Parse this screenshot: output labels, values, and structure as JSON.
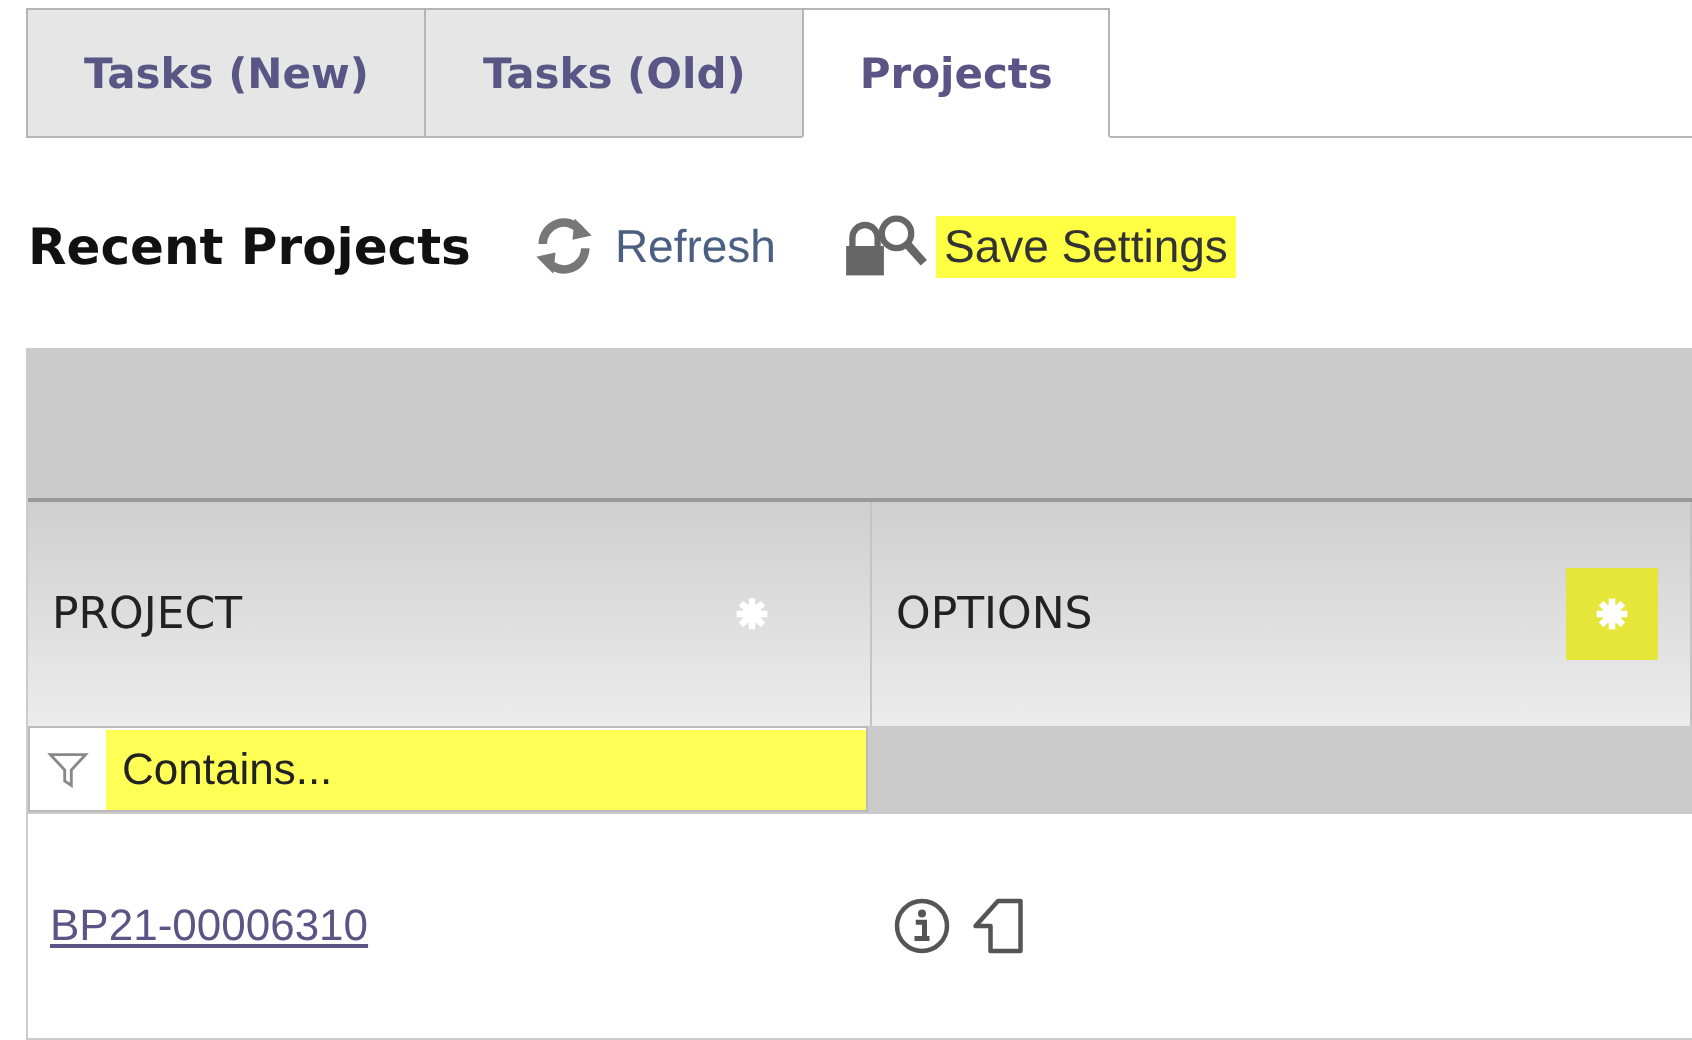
{
  "tabs": [
    {
      "label": "Tasks (New)",
      "selected": false
    },
    {
      "label": "Tasks (Old)",
      "selected": false
    },
    {
      "label": "Projects",
      "selected": true
    }
  ],
  "heading": "Recent Projects",
  "toolbar": [
    {
      "kind": "refresh",
      "label": "Refresh",
      "highlighted": false
    },
    {
      "kind": "save",
      "label": "Save Settings",
      "highlighted": true
    }
  ],
  "table": {
    "columns": [
      {
        "label": "PROJECT",
        "settings_highlighted": false
      },
      {
        "label": "OPTIONS",
        "settings_highlighted": true
      }
    ],
    "filter": {
      "placeholder": "Contains...",
      "highlighted": true
    },
    "rows": [
      {
        "project": "BP21-00006310"
      }
    ]
  }
}
